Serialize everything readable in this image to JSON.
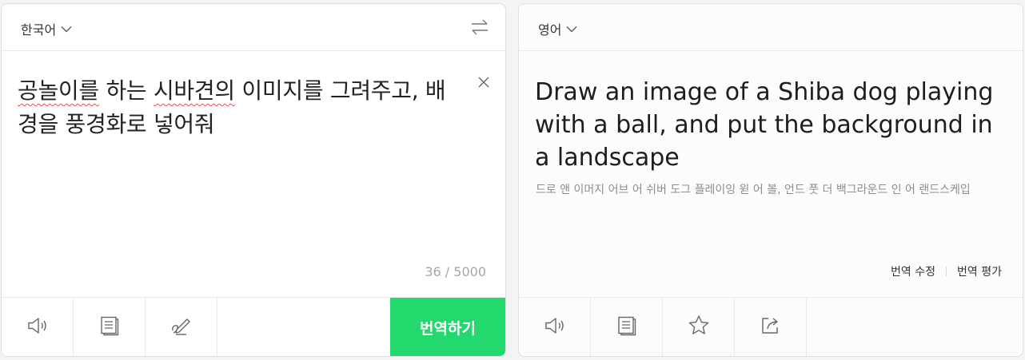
{
  "source": {
    "language": "한국어",
    "text_underlined": "공놀이를",
    "text_mid": " 하는 ",
    "text_underlined2": "시바견의",
    "text_rest": " 이미지를 그려주고, 배경을 풍경화로 넣어줘",
    "counter": "36 / 5000",
    "translate_button": "번역하기"
  },
  "target": {
    "language": "영어",
    "text": "Draw an image of a Shiba dog playing with a ball, and put the background in a landscape",
    "pronunciation": "드로 앤 이머지 어브 어 쉬버 도그 플레이잉 윋 어 볼, 언드 풋 더 백그라운드 인 어 랜드스케입",
    "edit_translation": "번역 수정",
    "rate_translation": "번역 평가"
  },
  "icons": {
    "source_toolbar": [
      "speaker-icon",
      "dictionary-icon",
      "handwriting-icon"
    ],
    "target_toolbar": [
      "speaker-icon",
      "dictionary-icon",
      "star-icon",
      "share-icon"
    ]
  },
  "colors": {
    "accent": "#23d96e",
    "spellcheck": "#e0504e"
  }
}
